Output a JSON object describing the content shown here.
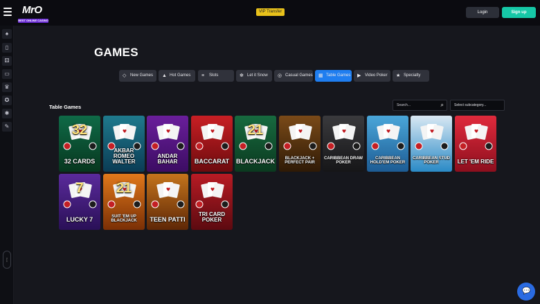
{
  "header": {
    "logo_text": "MrO",
    "logo_sub": "BEST ONLINE CASINO",
    "vip_label": "VIP Transfer",
    "login_label": "Login",
    "signup_label": "Sign up"
  },
  "sidebar": {
    "icons": [
      "hat-icon",
      "phone-icon",
      "dice-icon",
      "card-icon",
      "crown-icon",
      "badge-icon",
      "gear-icon",
      "edit-icon"
    ],
    "pill_label": "Dark"
  },
  "page_title": "GAMES",
  "tabs": [
    {
      "label": "New Games",
      "icon": "diamond-icon",
      "active": false
    },
    {
      "label": "Hot Games",
      "icon": "fire-icon",
      "active": false
    },
    {
      "label": "Slots",
      "icon": "slots-icon",
      "active": false
    },
    {
      "label": "Let it Snow",
      "icon": "snowflake-icon",
      "active": false
    },
    {
      "label": "Casual Games",
      "icon": "swirl-icon",
      "active": false
    },
    {
      "label": "Table Games",
      "icon": "table-icon",
      "active": true
    },
    {
      "label": "Video Poker",
      "icon": "video-icon",
      "active": false
    },
    {
      "label": "Specialty",
      "icon": "star-icon",
      "active": false
    }
  ],
  "section_label": "Table Games",
  "search": {
    "placeholder": "Search..."
  },
  "subcategory": {
    "placeholder": "Select subcategory..."
  },
  "games": [
    {
      "title": "32 CARDS",
      "top": "32",
      "colors": [
        "#0f6a47",
        "#07371f"
      ]
    },
    {
      "title": "AKBAR ROMEO WALTER",
      "colors": [
        "#1f7a8d",
        "#0b3c55"
      ]
    },
    {
      "title": "ANDAR BAHAR",
      "colors": [
        "#6a1e9b",
        "#3c0d63"
      ]
    },
    {
      "title": "BACCARAT",
      "colors": [
        "#c81f24",
        "#6c0b0e"
      ]
    },
    {
      "title": "BLACKJACK",
      "top": "21",
      "colors": [
        "#176a3f",
        "#0b3a20"
      ]
    },
    {
      "title": "BLACKJACK + PERFECT PAIR",
      "colors": [
        "#7a4a18",
        "#2f1a06"
      ]
    },
    {
      "title": "CARIBBEAN DRAW POKER",
      "colors": [
        "#3a3a3d",
        "#161618"
      ]
    },
    {
      "title": "CARIBBEAN HOLD'EM POKER",
      "colors": [
        "#4aa6d9",
        "#1d5c94"
      ]
    },
    {
      "title": "CARIBBEAN STUD POKER",
      "colors": [
        "#d9e8f3",
        "#2a8ac6"
      ]
    },
    {
      "title": "LET 'EM RIDE",
      "colors": [
        "#e02a3c",
        "#8d0f1e"
      ]
    },
    {
      "title": "LUCKY 7",
      "top": "7",
      "colors": [
        "#5a2a9b",
        "#2a1057"
      ]
    },
    {
      "title": "SUIT 'EM UP BLACKJACK",
      "top": "21",
      "colors": [
        "#e0781b",
        "#7a2f05"
      ]
    },
    {
      "title": "TEEN PATTI",
      "colors": [
        "#c4741c",
        "#5e2706"
      ]
    },
    {
      "title": "TRI CARD POKER",
      "colors": [
        "#b81b24",
        "#5c0a10"
      ]
    }
  ]
}
